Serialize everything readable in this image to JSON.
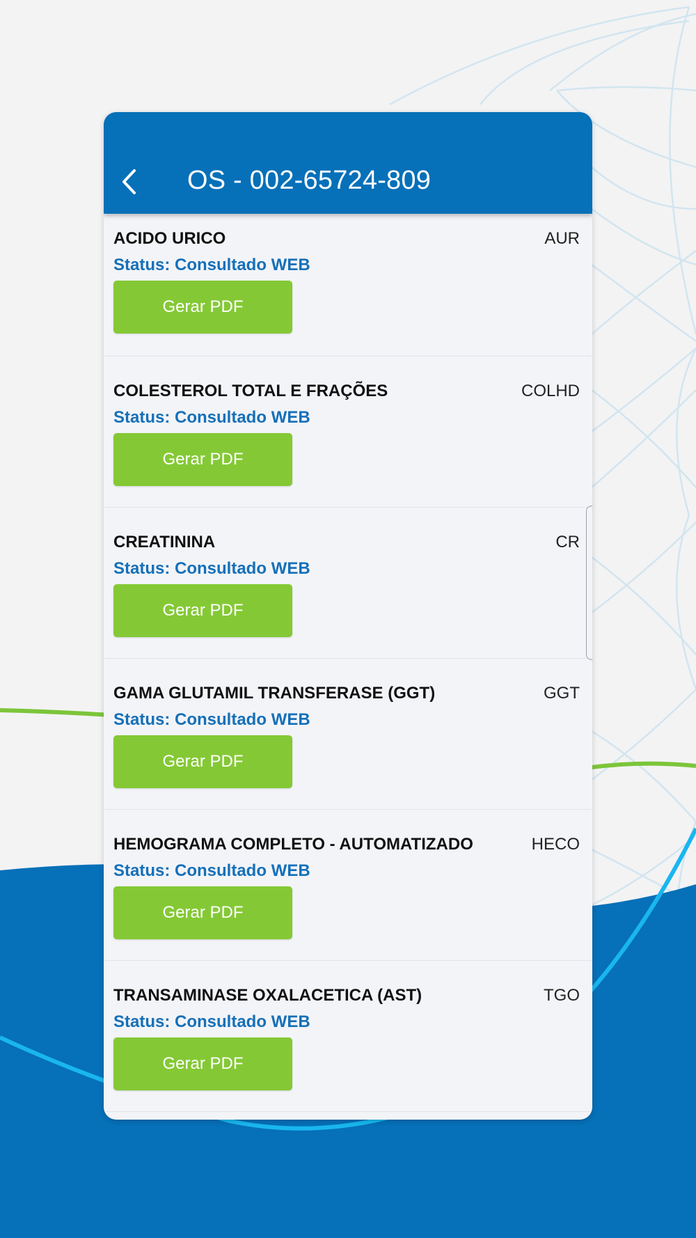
{
  "header": {
    "title": "OS - 002-65724-809",
    "back_icon": "chevron-left-icon"
  },
  "exams": [
    {
      "name": "ACIDO URICO",
      "code": "AUR",
      "status": "Status: Consultado WEB",
      "button": "Gerar PDF"
    },
    {
      "name": "COLESTEROL TOTAL E FRAÇÕES",
      "code": "COLHD",
      "status": "Status: Consultado WEB",
      "button": "Gerar PDF"
    },
    {
      "name": "CREATININA",
      "code": "CR",
      "status": "Status: Consultado WEB",
      "button": "Gerar PDF"
    },
    {
      "name": "GAMA GLUTAMIL TRANSFERASE (GGT)",
      "code": "GGT",
      "status": "Status: Consultado WEB",
      "button": "Gerar PDF"
    },
    {
      "name": "HEMOGRAMA COMPLETO - AUTOMATIZADO",
      "code": "HECO",
      "status": "Status: Consultado WEB",
      "button": "Gerar PDF"
    },
    {
      "name": "TRANSAMINASE OXALACETICA (AST)",
      "code": "TGO",
      "status": "Status: Consultado WEB",
      "button": "Gerar PDF"
    }
  ],
  "colors": {
    "header": "#0670b8",
    "status_text": "#1670b8",
    "button": "#84c935",
    "background_blue": "#0670b8"
  }
}
